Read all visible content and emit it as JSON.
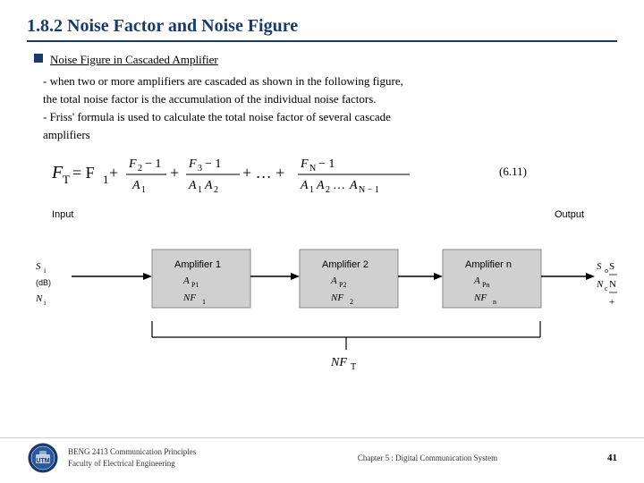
{
  "slide": {
    "title": "1.8.2 Noise Factor and Noise Figure",
    "bullet_heading": "Noise Figure in Cascaded Amplifier",
    "text1": "- when two or more amplifiers are cascaded as shown in the following figure,",
    "text2": "  the total noise factor is the accumulation of the individual noise factors.",
    "text3": "- Friss' formula is used to calculate the total noise factor of several cascade",
    "text4": "  amplifiers",
    "formula_number": "(6.11)",
    "diagram": {
      "input_label": "Input",
      "output_label": "Output",
      "amp1_label": "Amplifier 1",
      "amp1_gain": "Aₚ₁",
      "amp1_nf": "NF₁",
      "amp2_label": "Amplifier 2",
      "amp2_gain": "Aₚ₂",
      "amp2_nf": "NF₂",
      "amp3_label": "Amplifier n",
      "amp3_gain": "Aₚₙ",
      "amp3_nf": "NFₙ",
      "input_signal": "Sᵢ",
      "input_noise": "Nᵢ",
      "input_db": "(dB)",
      "output_eq": "Sₒ   Sᵢ",
      "output_eq2": "Nᵢ   Nᵢ",
      "nft_label": "NFᵀ"
    },
    "footer": {
      "line1": "BENG 2413 Communication Principles",
      "line2": "Faculty of Electrical Engineering",
      "center": "Chapter 5 : Digital Communication System",
      "page": "41"
    }
  }
}
